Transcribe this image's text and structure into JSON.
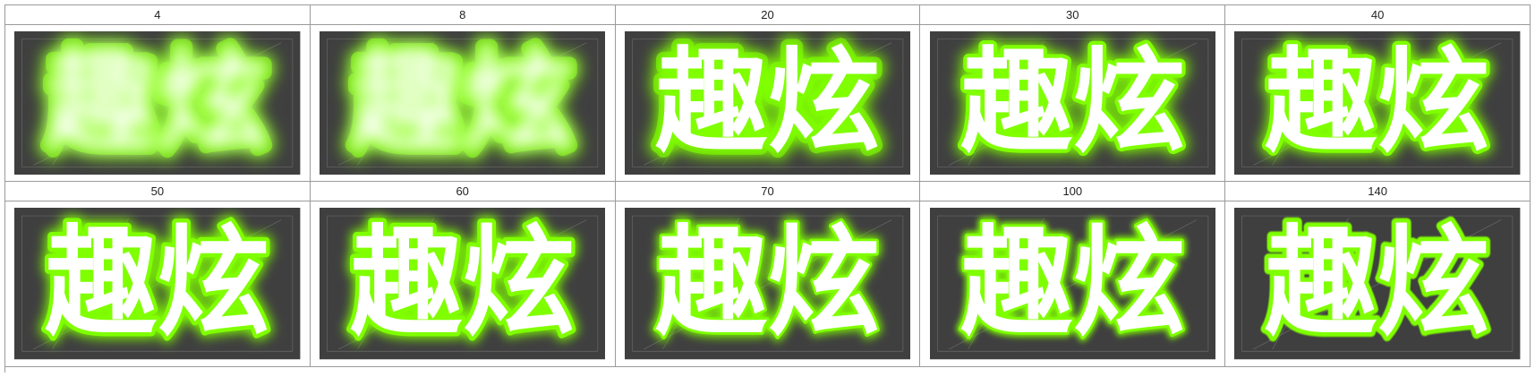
{
  "colors": {
    "background": "#ffffff",
    "grid_line": "#9a9a9a",
    "preview_background": "#3f3f3f",
    "glow": "#7fff00",
    "text_fill": "#ffffff"
  },
  "preview_text": "趣炫",
  "rows": [
    {
      "cells": [
        {
          "label": "4",
          "glow_level": 4
        },
        {
          "label": "8",
          "glow_level": 8
        },
        {
          "label": "20",
          "glow_level": 20
        },
        {
          "label": "30",
          "glow_level": 30
        },
        {
          "label": "40",
          "glow_level": 40
        }
      ]
    },
    {
      "cells": [
        {
          "label": "50",
          "glow_level": 50
        },
        {
          "label": "60",
          "glow_level": 60
        },
        {
          "label": "70",
          "glow_level": 70
        },
        {
          "label": "100",
          "glow_level": 100
        },
        {
          "label": "140",
          "glow_level": 140
        }
      ]
    }
  ]
}
